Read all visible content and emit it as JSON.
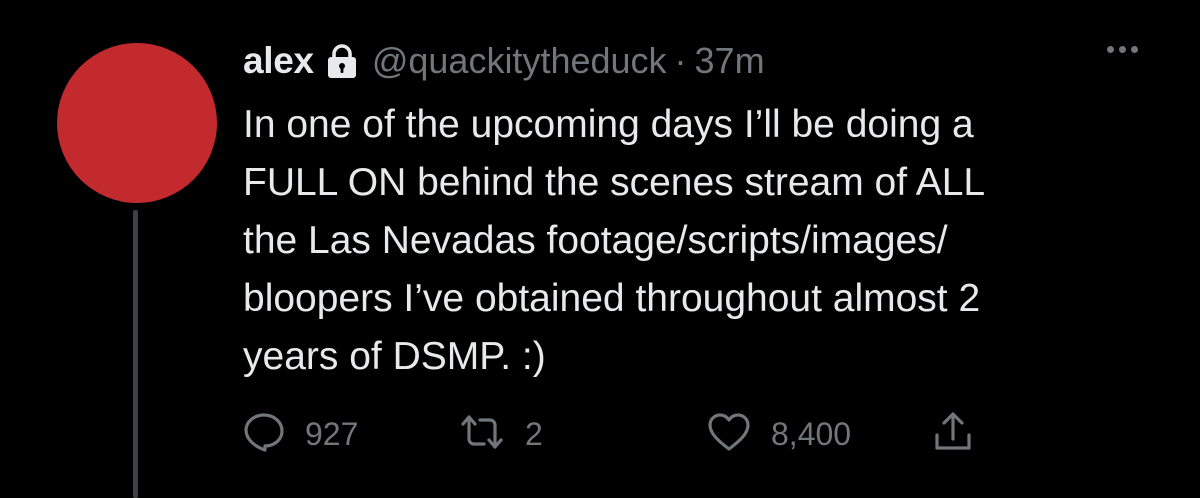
{
  "tweet": {
    "author_name": "alex",
    "handle": "@quackitytheduck",
    "separator": "·",
    "time": "37m",
    "text_lines": [
      "In one of the upcoming days I’ll be doing a",
      "FULL ON behind the scenes stream of ALL",
      "the Las Nevadas footage/scripts/images/",
      "bloopers I’ve obtained throughout almost 2",
      "years of DSMP. :)"
    ],
    "avatar_color": "#c22a2e",
    "protected_icon": "lock-icon",
    "more_icon": "more-dots-icon"
  },
  "actions": {
    "reply": {
      "icon": "reply-icon",
      "count": "927"
    },
    "retweet": {
      "icon": "retweet-icon",
      "count": "2"
    },
    "like": {
      "icon": "heart-icon",
      "count": "8,400"
    },
    "share": {
      "icon": "share-icon"
    }
  },
  "colors": {
    "background": "#000000",
    "text_primary": "#e7e9ea",
    "text_secondary": "#71767b"
  }
}
